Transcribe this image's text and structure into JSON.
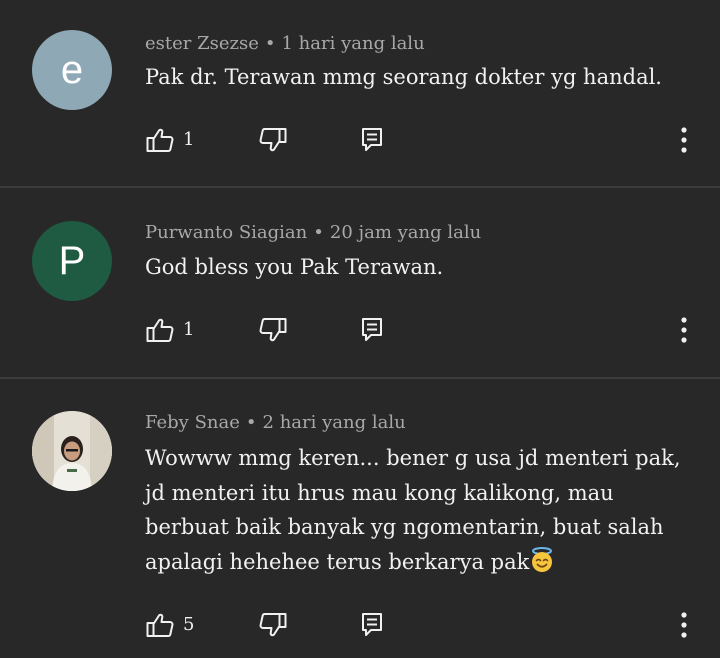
{
  "comments": [
    {
      "author": "ester Zsezse",
      "separator": "•",
      "time": "1 hari yang lalu",
      "avatar_letter": "e",
      "avatar_color": "#8fa8b5",
      "text": "Pak dr. Terawan mmg seorang dokter yg handal.",
      "likes": "1"
    },
    {
      "author": "Purwanto Siagian",
      "separator": "•",
      "time": "20 jam yang lalu",
      "avatar_letter": "P",
      "avatar_color": "#1e5b42",
      "text": "God bless you Pak Terawan.",
      "likes": "1"
    },
    {
      "author": "Feby Snae",
      "separator": "•",
      "time": "2 hari yang lalu",
      "avatar_letter": "",
      "avatar_color": "#d9d4c8",
      "text": "Wowww mmg keren... bener g usa jd menteri pak,\njd menteri itu hrus mau kong kalikong, mau\nberbuat baik banyak yg ngomentarin, buat salah\napalagi hehehee terus berkarya pak",
      "emoji": "smiling-face-with-halo",
      "likes": "5"
    }
  ]
}
